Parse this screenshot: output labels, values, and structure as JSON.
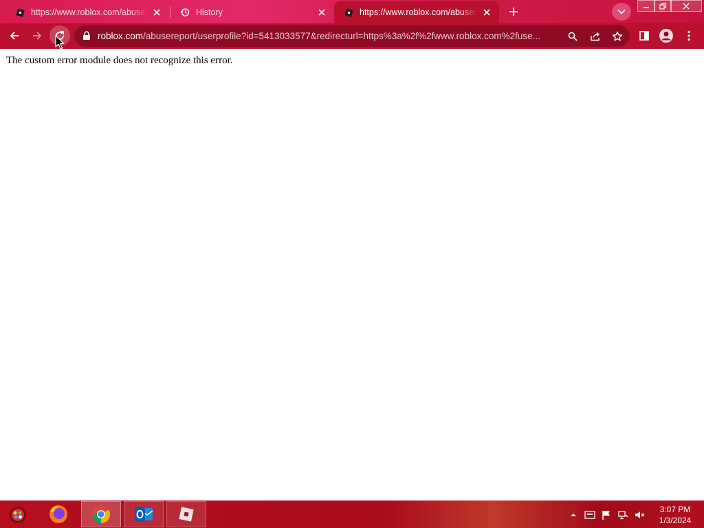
{
  "browser": {
    "tabs": [
      {
        "title": "https://www.roblox.com/abusere",
        "icon": "roblox-icon",
        "active": false
      },
      {
        "title": "History",
        "icon": "history-icon",
        "active": false
      },
      {
        "title": "https://www.roblox.com/abusere",
        "icon": "roblox-icon",
        "active": true
      }
    ],
    "address_bar": {
      "host": "roblox.com",
      "path": "/abusereport/userprofile?id=5413033577&redirecturl=https%3a%2f%2fwww.roblox.com%2fuse..."
    }
  },
  "page": {
    "error_message": "The custom error module does not recognize this error."
  },
  "taskbar": {
    "apps": [
      "firefox-icon",
      "chrome-icon",
      "outlook-icon",
      "roblox-icon"
    ],
    "clock": {
      "time": "3:07 PM",
      "date": "1/3/2024"
    }
  },
  "colors": {
    "tab_strip": "#d81b4e",
    "toolbar": "#b9102f",
    "omnibox": "#8e0a23",
    "taskbar": "#b50f1e"
  }
}
